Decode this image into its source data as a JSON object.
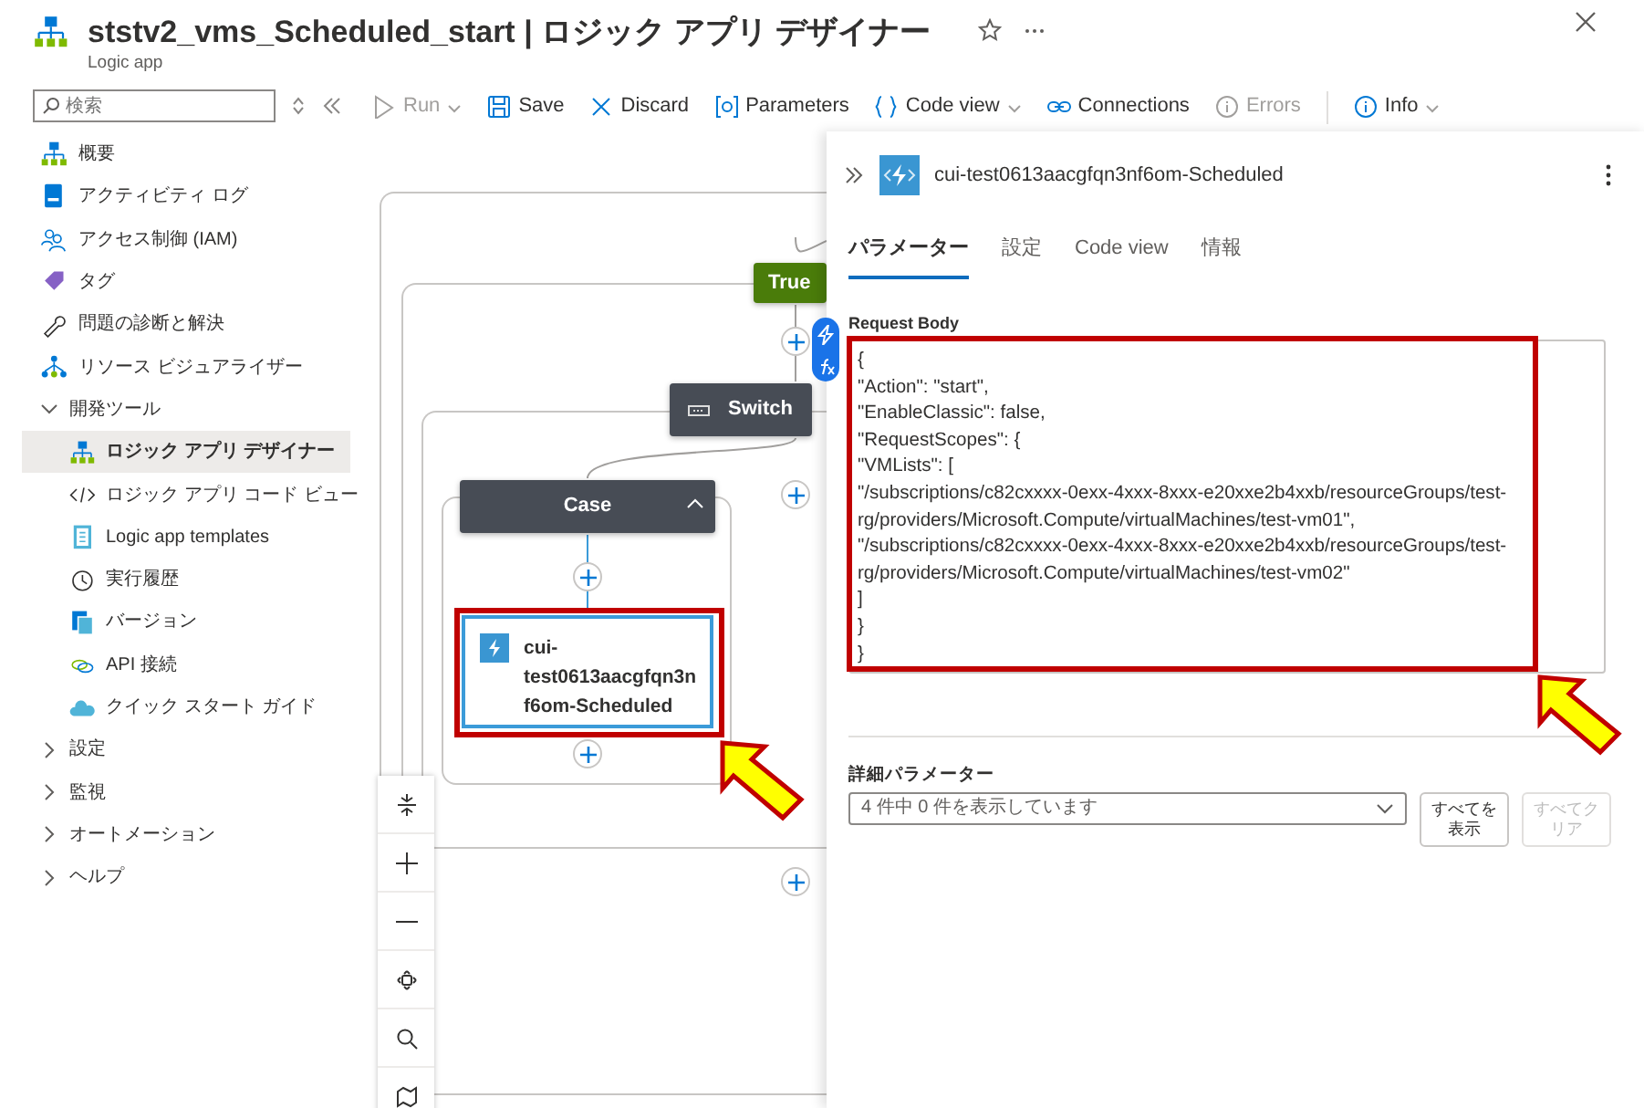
{
  "header": {
    "title": "ststv2_vms_Scheduled_start | ロジック アプリ デザイナー",
    "subtitle": "Logic app",
    "favorite": false
  },
  "sidebar": {
    "search": {
      "placeholder": "検索"
    },
    "items": [
      {
        "label": "概要",
        "selected": false
      },
      {
        "label": "アクティビティ ログ",
        "selected": false
      },
      {
        "label": "アクセス制御 (IAM)",
        "selected": false
      },
      {
        "label": "タグ",
        "selected": false
      },
      {
        "label": "問題の診断と解決",
        "selected": false
      },
      {
        "label": "リソース ビジュアライザー",
        "selected": false
      },
      {
        "label": "開発ツール",
        "selected": false,
        "expanded": true,
        "children": [
          {
            "label": "ロジック アプリ デザイナー",
            "selected": true
          },
          {
            "label": "ロジック アプリ コード ビュー",
            "selected": false
          },
          {
            "label": "Logic app templates",
            "selected": false
          },
          {
            "label": "実行履歴",
            "selected": false
          },
          {
            "label": "バージョン",
            "selected": false
          },
          {
            "label": "API 接続",
            "selected": false
          },
          {
            "label": "クイック スタート ガイド",
            "selected": false
          }
        ]
      },
      {
        "label": "設定",
        "selected": false,
        "expanded": false
      },
      {
        "label": "監視",
        "selected": false,
        "expanded": false
      },
      {
        "label": "オートメーション",
        "selected": false,
        "expanded": false
      },
      {
        "label": "ヘルプ",
        "selected": false,
        "expanded": false
      }
    ]
  },
  "toolbar": [
    {
      "label": "Run",
      "disabled": true,
      "dropdown": true
    },
    {
      "label": "Save",
      "disabled": false,
      "dropdown": false
    },
    {
      "label": "Discard",
      "disabled": false,
      "dropdown": false
    },
    {
      "label": "Parameters",
      "disabled": false,
      "dropdown": false
    },
    {
      "label": "Code view",
      "disabled": false,
      "dropdown": true
    },
    {
      "label": "Connections",
      "disabled": false,
      "dropdown": false
    },
    {
      "label": "Errors",
      "disabled": true,
      "dropdown": false
    },
    {
      "label": "Info",
      "disabled": false,
      "dropdown": true
    }
  ],
  "canvas": {
    "nodes": [
      {
        "kind": "condition",
        "label": "True"
      },
      {
        "kind": "switch",
        "label": "Switch"
      },
      {
        "kind": "case",
        "label": "Case"
      },
      {
        "kind": "action",
        "label": "cui-test0613aacgfqn3nf6om-Scheduled",
        "selected": true
      }
    ]
  },
  "panel": {
    "title": "cui-test0613aacgfqn3nf6om-Scheduled",
    "tabs": [
      {
        "label": "パラメーター",
        "selected": true
      },
      {
        "label": "設定",
        "selected": false
      },
      {
        "label": "Code view",
        "selected": false
      },
      {
        "label": "情報",
        "selected": false
      }
    ],
    "request_body": {
      "label": "Request Body",
      "value": "{\n\"Action\": \"start\",\n\"EnableClassic\": false,\n\"RequestScopes\": {\n\"VMLists\": [\n\"/subscriptions/c82cxxxx-0exx-4xxx-8xxx-e20xxe2b4xxb/resourceGroups/test-rg/providers/Microsoft.Compute/virtualMachines/test-vm01\",\n\"/subscriptions/c82cxxxx-0exx-4xxx-8xxx-e20xxe2b4xxb/resourceGroups/test-rg/providers/Microsoft.Compute/virtualMachines/test-vm02\"\n]\n}\n}"
    },
    "advanced": {
      "label": "詳細パラメーター",
      "placeholder": "4 件中 0 件を表示しています"
    },
    "buttons": [
      {
        "label": "すべてを表示",
        "disabled": false
      },
      {
        "label": "すべてクリア",
        "disabled": true
      }
    ]
  }
}
